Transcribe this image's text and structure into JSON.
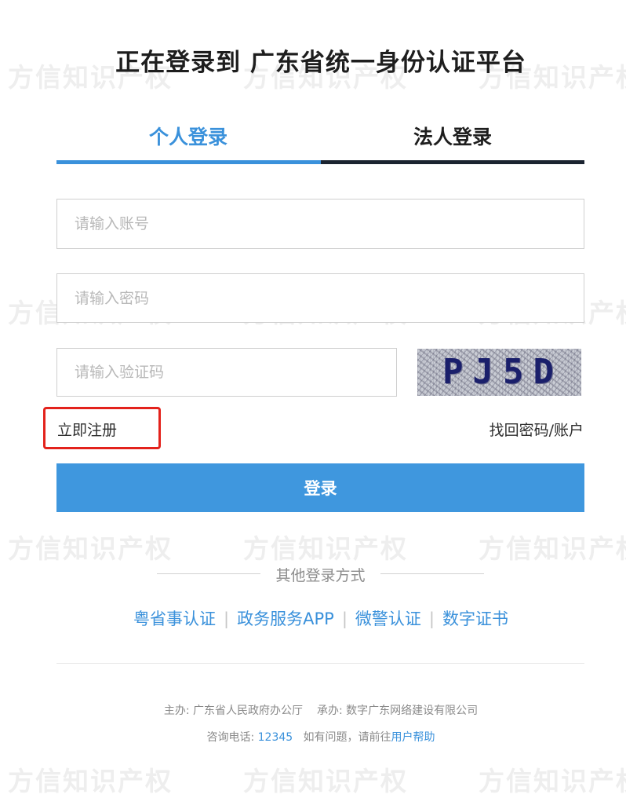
{
  "page": {
    "title": "正在登录到 广东省统一身份认证平台"
  },
  "tabs": [
    {
      "label": "个人登录",
      "active": true
    },
    {
      "label": "法人登录",
      "active": false
    }
  ],
  "form": {
    "account_placeholder": "请输入账号",
    "password_placeholder": "请输入密码",
    "captcha_placeholder": "请输入验证码",
    "captcha_text": "PJ5D",
    "register_label": "立即注册",
    "forgot_label": "找回密码/账户",
    "login_label": "登录"
  },
  "other_login": {
    "label": "其他登录方式",
    "methods": [
      "粤省事认证",
      "政务服务APP",
      "微警认证",
      "数字证书"
    ],
    "separator": "|"
  },
  "footer": {
    "host": "主办: 广东省人民政府办公厅",
    "contractor": "承办: 数字广东网络建设有限公司",
    "hotline_label": "咨询电话:",
    "hotline_number": "12345",
    "question_text": "如有问题，请前往",
    "help_link": "用户帮助"
  },
  "watermark": "方信知识产权",
  "colors": {
    "accent": "#3a91db",
    "login_button": "#3f97de",
    "highlight_box": "#e3221c",
    "tab_inactive_bar": "#1b2430"
  }
}
